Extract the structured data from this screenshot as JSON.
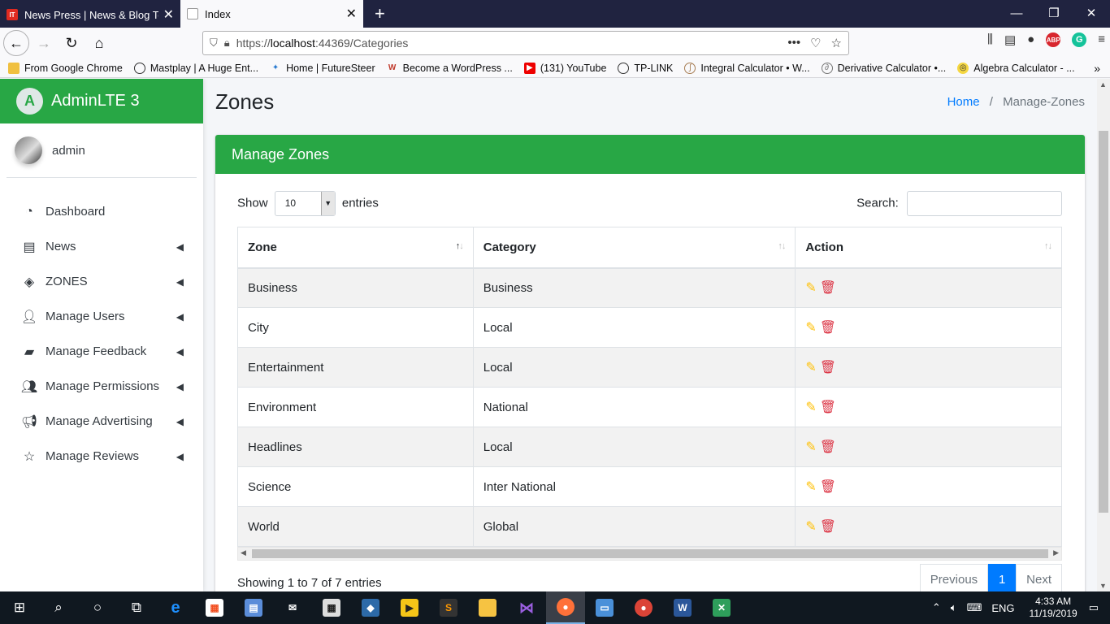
{
  "browser": {
    "tabs": [
      {
        "title": "News Press | News & Blog Tem",
        "active": false
      },
      {
        "title": "Index",
        "active": true
      }
    ],
    "url_prefix": "https://",
    "url_host": "localhost",
    "url_rest": ":44369/Categories",
    "bookmarks": [
      "From Google Chrome",
      "Mastplay | A Huge Ent...",
      "Home | FutureSteer",
      "Become a WordPress ...",
      "(131) YouTube",
      "TP-LINK",
      "Integral Calculator • W...",
      "Derivative Calculator •...",
      "Algebra Calculator - ..."
    ]
  },
  "sidebar": {
    "brand": "AdminLTE 3",
    "logo_letter": "A",
    "user": "admin",
    "items": [
      {
        "label": "Dashboard",
        "icon": "dashboard-icon",
        "chevron": false
      },
      {
        "label": "News",
        "icon": "newspaper-icon",
        "chevron": true
      },
      {
        "label": "ZONES",
        "icon": "layers-icon",
        "chevron": true
      },
      {
        "label": "Manage Users",
        "icon": "user-icon",
        "chevron": true
      },
      {
        "label": "Manage Feedback",
        "icon": "comment-icon",
        "chevron": true
      },
      {
        "label": "Manage Permissions",
        "icon": "user-lock-icon",
        "chevron": true
      },
      {
        "label": "Manage Advertising",
        "icon": "megaphone-icon",
        "chevron": true
      },
      {
        "label": "Manage Reviews",
        "icon": "star-icon",
        "chevron": true
      }
    ]
  },
  "header": {
    "title": "Zones",
    "breadcrumb_home": "Home",
    "breadcrumb_sep": "/",
    "breadcrumb_current": "Manage-Zones"
  },
  "card": {
    "title": "Manage Zones",
    "show_label": "Show",
    "entries_value": "10",
    "entries_label": "entries",
    "search_label": "Search:",
    "search_value": "",
    "columns": [
      "Zone",
      "Category",
      "Action"
    ],
    "rows": [
      {
        "zone": "Business",
        "category": "Business"
      },
      {
        "zone": "City",
        "category": "Local"
      },
      {
        "zone": "Entertainment",
        "category": "Local"
      },
      {
        "zone": "Environment",
        "category": "National"
      },
      {
        "zone": "Headlines",
        "category": "Local"
      },
      {
        "zone": "Science",
        "category": "Inter National"
      },
      {
        "zone": "World",
        "category": "Global"
      }
    ],
    "info": "Showing 1 to 7 of 7 entries",
    "prev_label": "Previous",
    "current_page": "1",
    "next_label": "Next"
  },
  "taskbar": {
    "lang": "ENG",
    "time": "4:33 AM",
    "date": "11/19/2019"
  },
  "colors": {
    "brand_green": "#28a745",
    "link_blue": "#007bff",
    "edit_yellow": "#ffc107",
    "delete_red": "#dc3545"
  }
}
